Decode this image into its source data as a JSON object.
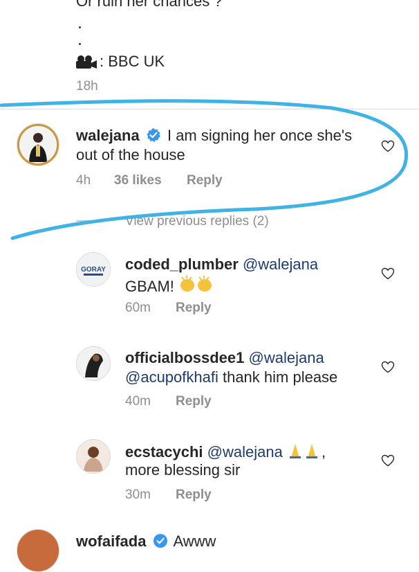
{
  "caption": {
    "line1": "Or ruin her chances ?",
    "credit": ": BBC UK",
    "time": "18h"
  },
  "comment_main": {
    "username": "walejana",
    "text_line1": "I am signing her once she's",
    "text_line2": "out of the house",
    "time": "4h",
    "likes": "36 likes",
    "reply": "Reply",
    "view_replies": "View previous replies (2)"
  },
  "replies": [
    {
      "username": "coded_plumber",
      "mention": "@walejana",
      "text_line2": "GBAM!",
      "time": "60m",
      "reply": "Reply",
      "avatar_text": "GORAY"
    },
    {
      "username": "officialbossdee1",
      "mention": "@walejana",
      "mention2": "@acupofkhafi",
      "text_line2": " thank him please",
      "time": "40m",
      "reply": "Reply"
    },
    {
      "username": "ecstacychi",
      "mention": "@walejana",
      "text_tail": ",",
      "text_line2": "more blessing sir",
      "time": "30m",
      "reply": "Reply"
    }
  ],
  "next_comment": {
    "username": "wofaifada",
    "text": "Awww"
  },
  "colors": {
    "annotation": "#3fb2e6",
    "verified": "#3897f0",
    "meta": "#8e8e8e"
  }
}
